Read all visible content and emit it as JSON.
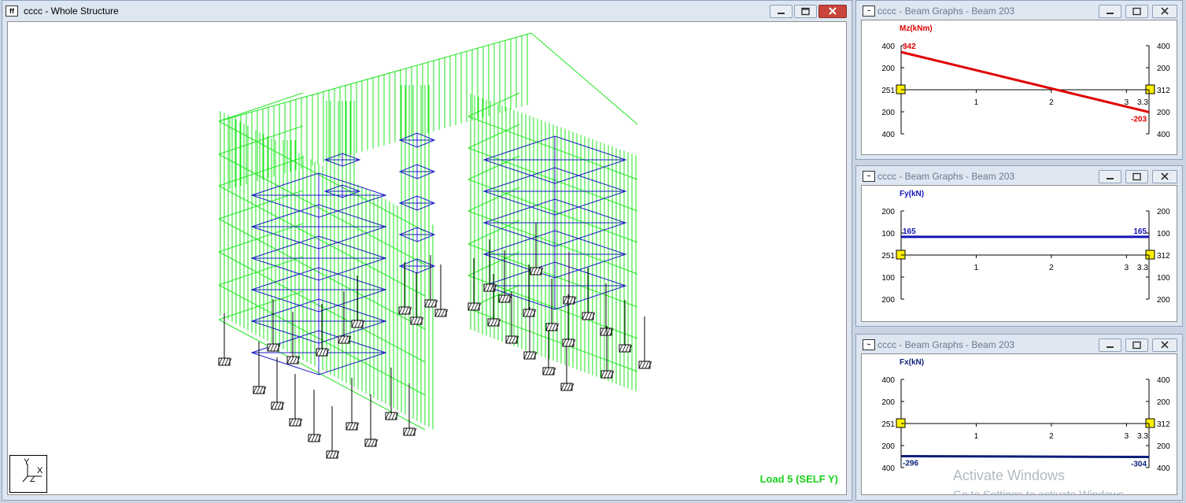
{
  "main_window": {
    "icon_label": "ff",
    "title": "cccc - Whole Structure",
    "load_label": "Load 5 (SELF Y)",
    "axis_labels": {
      "y": "Y",
      "x": "X",
      "z": "Z"
    }
  },
  "beam_windows": [
    {
      "title": "cccc - Beam Graphs - Beam 203",
      "quantity_label": "Mz(kNm)",
      "color": "#e00000",
      "left_ticks": [
        "400",
        "200",
        "251",
        "200",
        "400"
      ],
      "right_ticks": [
        "400",
        "200",
        "312",
        "200",
        "400"
      ],
      "x_ticks": [
        "1",
        "2",
        "3",
        "3.3"
      ],
      "start_value": "342",
      "end_value": "-203",
      "start": 342,
      "end": -203
    },
    {
      "title": "cccc - Beam Graphs - Beam 203",
      "quantity_label": "Fy(kN)",
      "color": "#1414b4",
      "left_ticks": [
        "200",
        "100",
        "251",
        "100",
        "200"
      ],
      "right_ticks": [
        "200",
        "100",
        "312",
        "100",
        "200"
      ],
      "x_ticks": [
        "1",
        "2",
        "3",
        "3.3"
      ],
      "start_value": "165",
      "end_value": "165",
      "start": 165,
      "end": 165
    },
    {
      "title": "cccc - Beam Graphs - Beam 203",
      "quantity_label": "Fx(kN)",
      "color": "#0c1f7a",
      "left_ticks": [
        "400",
        "200",
        "251",
        "200",
        "400"
      ],
      "right_ticks": [
        "400",
        "200",
        "312",
        "200",
        "400"
      ],
      "x_ticks": [
        "1",
        "2",
        "3",
        "3.3"
      ],
      "start_value": "-296",
      "end_value": "-304",
      "start": -296,
      "end": -304
    }
  ],
  "watermark": {
    "line1": "Activate Windows",
    "line2": "Go to Settings to activate Windows."
  },
  "colors": {
    "loads": "#1ee61e",
    "plates": "#1c1cc8",
    "supports": "#000000"
  }
}
